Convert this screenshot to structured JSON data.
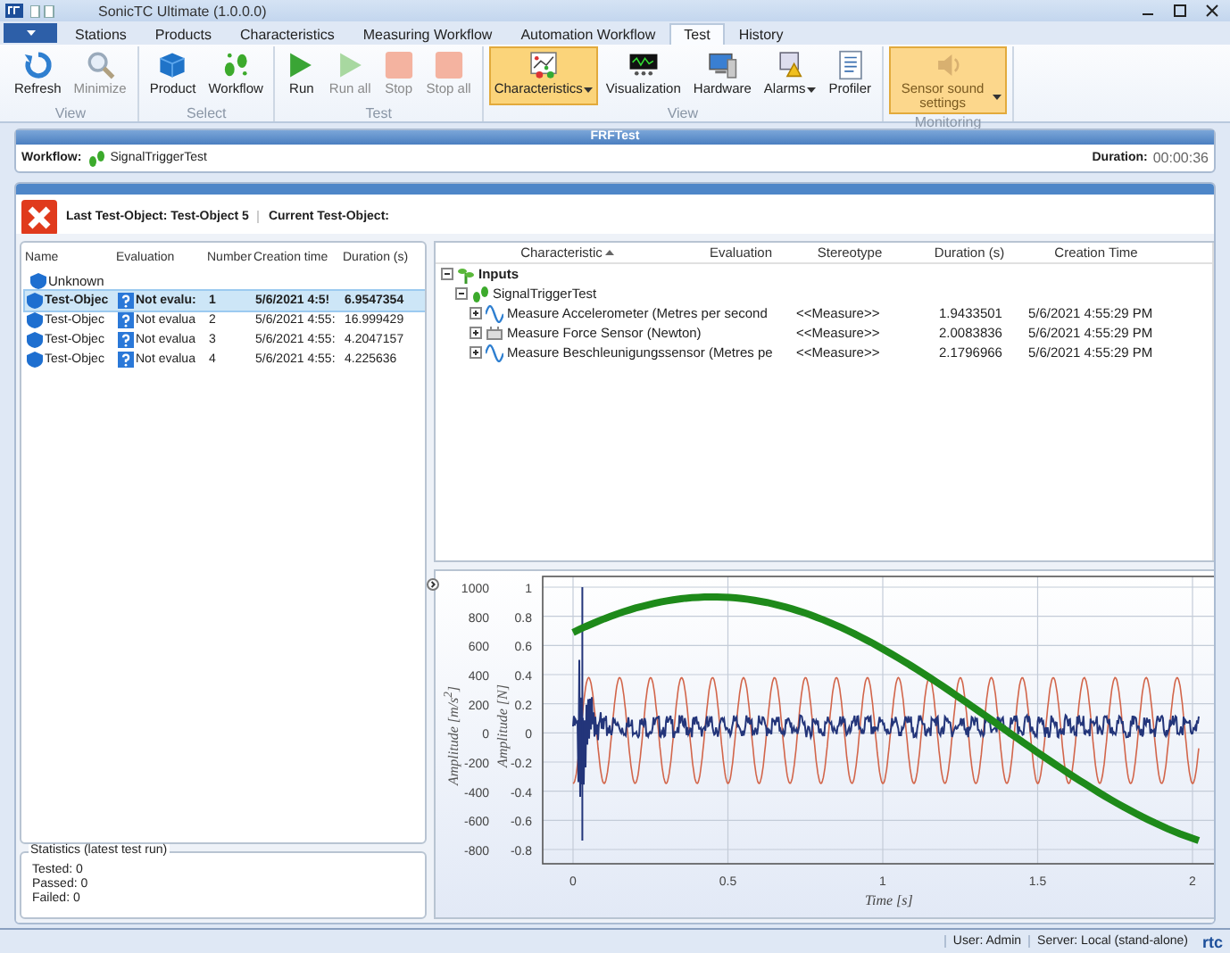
{
  "window": {
    "title": "SonicTC Ultimate (1.0.0.0)"
  },
  "tabs": [
    {
      "label": "Stations",
      "selected": false
    },
    {
      "label": "Products",
      "selected": false
    },
    {
      "label": "Characteristics",
      "selected": false
    },
    {
      "label": "Measuring Workflow",
      "selected": false
    },
    {
      "label": "Automation Workflow",
      "selected": false
    },
    {
      "label": "Test",
      "selected": true
    },
    {
      "label": "History",
      "selected": false
    }
  ],
  "ribbon_groups": [
    {
      "label": "View",
      "buttons": [
        {
          "label": "Refresh",
          "kind": "refresh",
          "disabled": false,
          "selected": false,
          "has_menu": false
        },
        {
          "label": "Minimize",
          "kind": "zoom",
          "disabled": true,
          "selected": false,
          "has_menu": false
        }
      ]
    },
    {
      "label": "Select",
      "buttons": [
        {
          "label": "Product",
          "kind": "cube",
          "disabled": false,
          "selected": false,
          "has_menu": false
        },
        {
          "label": "Workflow",
          "kind": "steps",
          "disabled": false,
          "selected": false,
          "has_menu": false
        }
      ]
    },
    {
      "label": "Test",
      "buttons": [
        {
          "label": "Run",
          "kind": "play",
          "disabled": false,
          "selected": false,
          "has_menu": false
        },
        {
          "label": "Run all",
          "kind": "play",
          "disabled": true,
          "selected": false,
          "has_menu": false
        },
        {
          "label": "Stop",
          "kind": "stop",
          "disabled": true,
          "selected": false,
          "has_menu": false
        },
        {
          "label": "Stop all",
          "kind": "stop",
          "disabled": true,
          "selected": false,
          "has_menu": false
        }
      ]
    },
    {
      "label": "View",
      "buttons": [
        {
          "label": "Characteristics",
          "kind": "scatter",
          "disabled": false,
          "selected": true,
          "has_menu": true
        },
        {
          "label": "Visualization",
          "kind": "scope",
          "disabled": false,
          "selected": false,
          "has_menu": false
        },
        {
          "label": "Hardware",
          "kind": "computer",
          "disabled": false,
          "selected": false,
          "has_menu": false
        },
        {
          "label": "Alarms",
          "kind": "alarm",
          "disabled": false,
          "selected": false,
          "has_menu": true
        },
        {
          "label": "Profiler",
          "kind": "list",
          "disabled": false,
          "selected": false,
          "has_menu": false
        }
      ]
    },
    {
      "label": "Monitoring",
      "buttons": [
        {
          "label": "Sensor sound settings",
          "kind": "speaker",
          "disabled": true,
          "selected": true,
          "has_menu": true
        }
      ]
    }
  ],
  "test_header": {
    "title": "FRFTest",
    "workflow_label": "Workflow:",
    "workflow": "SignalTriggerTest",
    "duration_label": "Duration:",
    "duration": "00:00:36"
  },
  "test_object": {
    "last": "Last Test-Object: Test-Object 5",
    "current": "Current Test-Object:"
  },
  "objects": {
    "columns": [
      "Name",
      "Evaluation",
      "Number",
      "Creation time",
      "Duration (s)"
    ],
    "groups": [
      {
        "name": "Unknown",
        "rows": [
          {
            "name": "Test-Objec",
            "evaluation": "Not evalu:",
            "number": "1",
            "created": "5/6/2021 4:5!",
            "duration": "6.9547354",
            "selected": true
          },
          {
            "name": "Test-Objec",
            "evaluation": "Not evalua",
            "number": "2",
            "created": "5/6/2021 4:55:",
            "duration": "16.999429",
            "selected": false
          },
          {
            "name": "Test-Objec",
            "evaluation": "Not evalua",
            "number": "3",
            "created": "5/6/2021 4:55:",
            "duration": "4.2047157",
            "selected": false
          },
          {
            "name": "Test-Objec",
            "evaluation": "Not evalua",
            "number": "4",
            "created": "5/6/2021 4:55:",
            "duration": "4.225636",
            "selected": false
          }
        ]
      }
    ]
  },
  "statistics": {
    "title": "Statistics (latest test run)",
    "lines": [
      "Tested: 0",
      "Passed: 0",
      "Failed: 0"
    ]
  },
  "characteristics": {
    "columns": [
      {
        "label": "Characteristic",
        "sorted": true
      },
      {
        "label": "Evaluation",
        "sorted": false
      },
      {
        "label": "Stereotype",
        "sorted": false
      },
      {
        "label": "Duration (s)",
        "sorted": false
      },
      {
        "label": "Creation Time",
        "sorted": false
      }
    ],
    "tree": [
      {
        "name": "Inputs",
        "kind": "inputs",
        "expanded": true,
        "children": [
          {
            "name": "SignalTriggerTest",
            "kind": "workflow",
            "expanded": true,
            "children": [
              {
                "name": "Measure Accelerometer (Metres per second",
                "kind": "wave",
                "expanded": false,
                "stereotype": "<<Measure>>",
                "duration": "1.9433501",
                "created": "5/6/2021 4:55:29 PM"
              },
              {
                "name": "Measure Force Sensor (Newton)",
                "kind": "sensor",
                "expanded": false,
                "stereotype": "<<Measure>>",
                "duration": "2.0083836",
                "created": "5/6/2021 4:55:29 PM"
              },
              {
                "name": "Measure Beschleunigungssensor (Metres pe",
                "kind": "wave",
                "expanded": false,
                "stereotype": "<<Measure>>",
                "duration": "2.1796966",
                "created": "5/6/2021 4:55:29 PM"
              }
            ]
          }
        ]
      }
    ]
  },
  "plot": {
    "left_ticks": [
      "1000",
      "800",
      "600",
      "400",
      "200",
      "0",
      "-200",
      "-400",
      "-600",
      "-800"
    ],
    "right_ticks": [
      "1",
      "0.8",
      "0.6",
      "0.4",
      "0.2",
      "0",
      "-0.2",
      "-0.4",
      "-0.6",
      "-0.8"
    ],
    "x_ticks": [
      "0",
      "0.5",
      "1",
      "1.5",
      "2"
    ],
    "left_label": "Amplitude [m/s$^{2}$]",
    "right_label": "Amplitude [N]",
    "x_label": "Time [s]"
  },
  "status_bar": {
    "user": "User: Admin",
    "server": "Server: Local (stand-alone)",
    "logo": "rtc"
  }
}
